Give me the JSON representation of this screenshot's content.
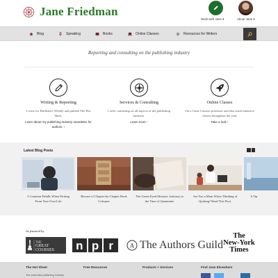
{
  "header": {
    "site_title": "Jane Friedman",
    "work_label": "Work with Jane ▾",
    "about_label": "About Jane ▾"
  },
  "nav": {
    "items": [
      {
        "label": "Blog",
        "icon": "star-icon"
      },
      {
        "label": "Speaking",
        "icon": "microphone-icon"
      },
      {
        "label": "Books",
        "icon": "book-icon"
      },
      {
        "label": "Online Classes",
        "icon": "laptop-icon"
      },
      {
        "label": "Resources for Writers",
        "icon": "gear-icon"
      }
    ],
    "search_icon": "search-icon"
  },
  "tagline": "Reporting and consulting on the publishing industry",
  "services": [
    {
      "title": "Writing & Reporting",
      "text": "I write for Publishers Weekly and publish The Hot Sheet.",
      "link": "Learn about my publishing industry newsletter for authors. ›",
      "icon": "pencil-icon"
    },
    {
      "title": "Services & Consulting",
      "text": "I offer consulting on all aspects of the publishing business.",
      "link": "Learn more ›",
      "icon": "compass-icon"
    },
    {
      "title": "Online Classes",
      "text": "I'm a Great Courses professor and also teach intensive classes throughout the year.",
      "link": "Take a look ›",
      "icon": "rocket-icon"
    }
  ],
  "blog": {
    "heading": "Latest Blog Posts",
    "posts": [
      {
        "title": "3 Common Pitfalls When Writing From Your Own Life"
      },
      {
        "title": "Beware of Chapter-by-Chapter Book Critiques"
      },
      {
        "title": "The Green-Eyed Monster: Jealousy in the Time of Quarantine"
      },
      {
        "title": "Are You a Mom Writer Thinking of Quitting? Read This First."
      },
      {
        "title": "6 Tip"
      }
    ]
  },
  "featured": {
    "label": "As featured by",
    "great_courses": [
      "THE",
      "GREAT",
      "COURSES"
    ],
    "npr": [
      "n",
      "p",
      "r"
    ],
    "authors_guild": "The Authors Guild",
    "nyt": [
      "The",
      "New-York",
      "Times"
    ]
  },
  "footer": {
    "columns": [
      "The Hot Sheet",
      "Free Resources",
      "Products + Services",
      "Find Jane Elsewhere"
    ],
    "hot_sheet_sub": "The essential publishing industry"
  },
  "colors": {
    "brand_green": "#2a7a2a",
    "nav_bg": "#e2e2e2",
    "blog_bg": "#f1f1f1",
    "footer_bg": "#dcdcdc"
  }
}
